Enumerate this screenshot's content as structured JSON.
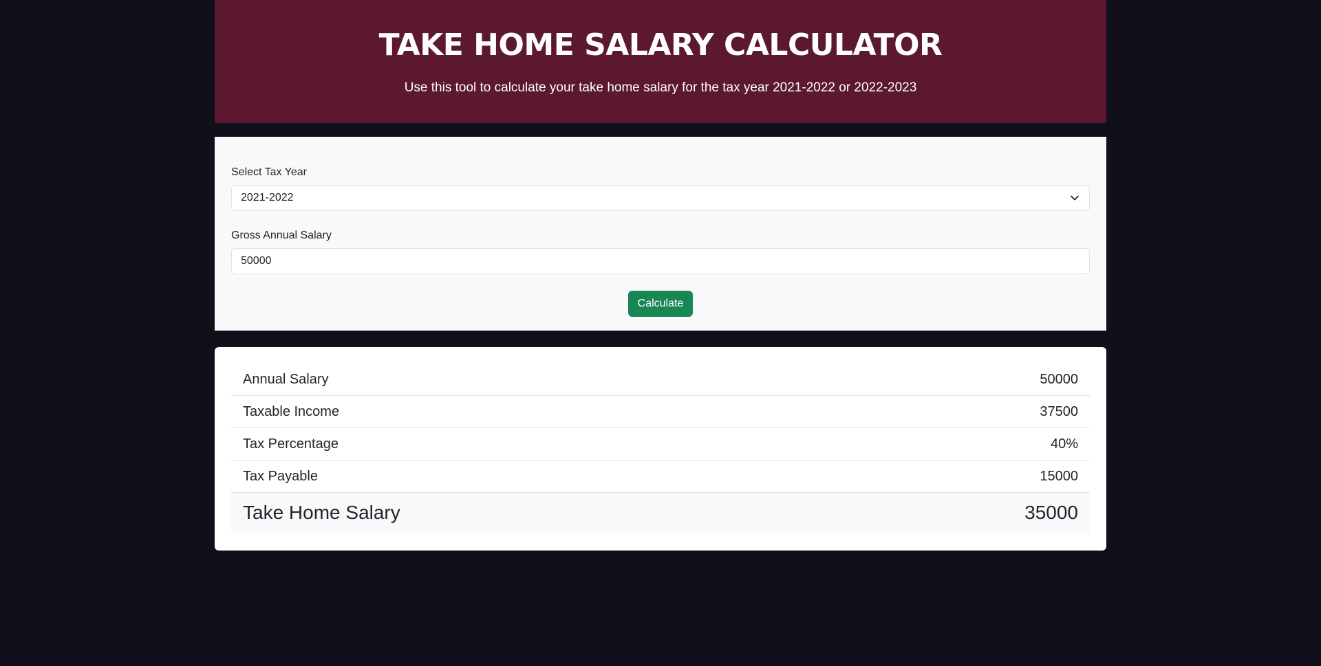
{
  "header": {
    "title": "TAKE HOME SALARY CALCULATOR",
    "subtitle": "Use this tool to calculate your take home salary for the tax year 2021-2022 or 2022-2023"
  },
  "form": {
    "tax_year_label": "Select Tax Year",
    "tax_year_value": "2021-2022",
    "salary_label": "Gross Annual Salary",
    "salary_value": "50000",
    "calculate_label": "Calculate"
  },
  "results": {
    "rows": [
      {
        "label": "Annual Salary",
        "value": "50000"
      },
      {
        "label": "Taxable Income",
        "value": "37500"
      },
      {
        "label": "Tax Percentage",
        "value": "40%"
      },
      {
        "label": "Tax Payable",
        "value": "15000"
      }
    ],
    "total": {
      "label": "Take Home Salary",
      "value": "35000"
    }
  },
  "colors": {
    "page_background": "#100f1a",
    "header_background": "#5c1830",
    "button": "#198754"
  },
  "icons": {
    "select_chevron": "chevron-down-icon"
  }
}
